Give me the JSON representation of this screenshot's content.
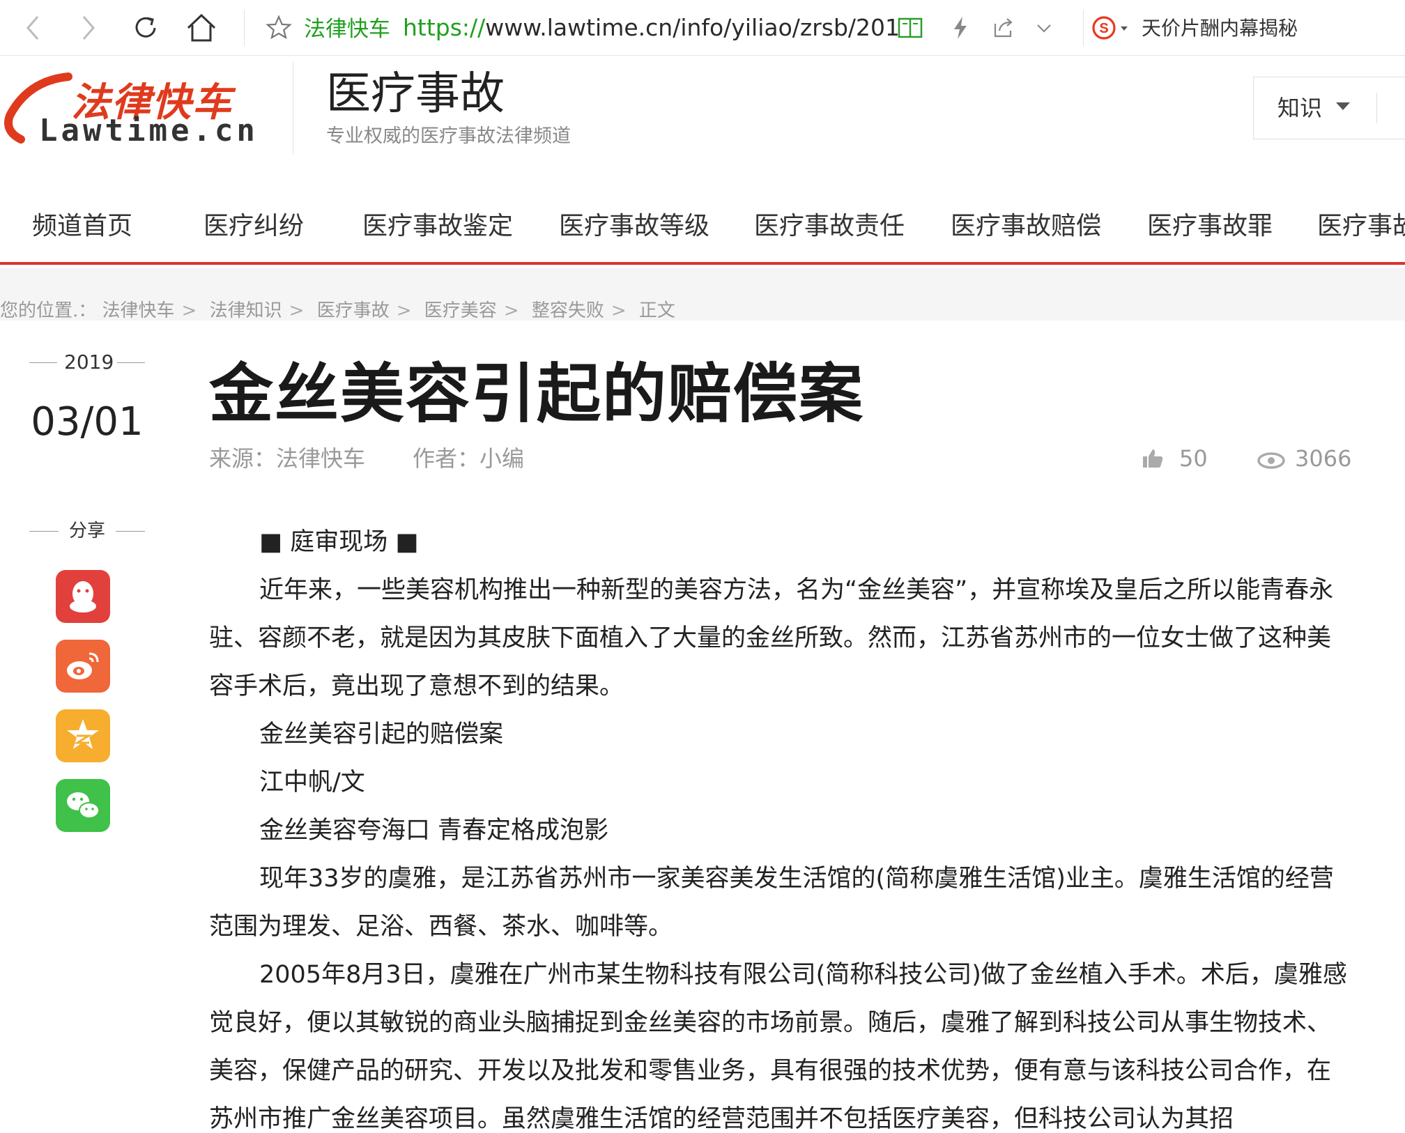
{
  "browser": {
    "site_name": "法律快车",
    "url_scheme": "https://",
    "url_rest": "www.lawtime.cn/info/yiliao/zrsb/201",
    "search_hint": "天价片酬内幕揭秘"
  },
  "header": {
    "logo_cn": "法律快车",
    "logo_en": "Lawtime.cn",
    "channel_title": "医疗事故",
    "channel_subtitle": "专业权威的医疗事故法律频道",
    "knowledge_select": "知识"
  },
  "nav": {
    "items": [
      "频道首页",
      "医疗纠纷",
      "医疗事故鉴定",
      "医疗事故等级",
      "医疗事故责任",
      "医疗事故赔偿",
      "医疗事故罪",
      "医疗事故"
    ]
  },
  "breadcrumb": {
    "prefix": "您的位置.：",
    "items": [
      "法律快车",
      "法律知识",
      "医疗事故",
      "医疗美容",
      "整容失败",
      "正文"
    ]
  },
  "sidebar": {
    "year": "2019",
    "date": "03/01",
    "share_label": "分享",
    "share_buttons": [
      "qq-icon",
      "weibo-icon",
      "qzone-icon",
      "wechat-icon"
    ]
  },
  "article": {
    "title": "金丝美容引起的赔偿案",
    "source": "来源：法律快车",
    "author": "作者：小编",
    "likes": "50",
    "views": "3066",
    "paragraphs": [
      "■ 庭审现场 ■",
      "近年来，一些美容机构推出一种新型的美容方法，名为“金丝美容”，并宣称埃及皇后之所以能青春永驻、容颜不老，就是因为其皮肤下面植入了大量的金丝所致。然而，江苏省苏州市的一位女士做了这种美容手术后，竟出现了意想不到的结果。",
      "金丝美容引起的赔偿案",
      "江中帆/文",
      "金丝美容夸海口 青春定格成泡影",
      "现年33岁的虞雅，是江苏省苏州市一家美容美发生活馆的(简称虞雅生活馆)业主。虞雅生活馆的经营范围为理发、足浴、西餐、茶水、咖啡等。",
      "2005年8月3日，虞雅在广州市某生物科技有限公司(简称科技公司)做了金丝植入手术。术后，虞雅感觉良好，便以其敏锐的商业头脑捕捉到金丝美容的市场前景。随后，虞雅了解到科技公司从事生物技术、美容，保健产品的研究、开发以及批发和零售业务，具有很强的技术优势，便有意与该科技公司合作，在苏州市推广金丝美容项目。虽然虞雅生活馆的经营范围并不包括医疗美容，但科技公司认为其招"
    ]
  },
  "colors": {
    "accent_red": "#e03030",
    "url_green": "#1fa01f",
    "qq": "#e2403d",
    "weibo": "#f0673a",
    "qzone": "#f7ad2e",
    "wechat": "#40c149"
  }
}
